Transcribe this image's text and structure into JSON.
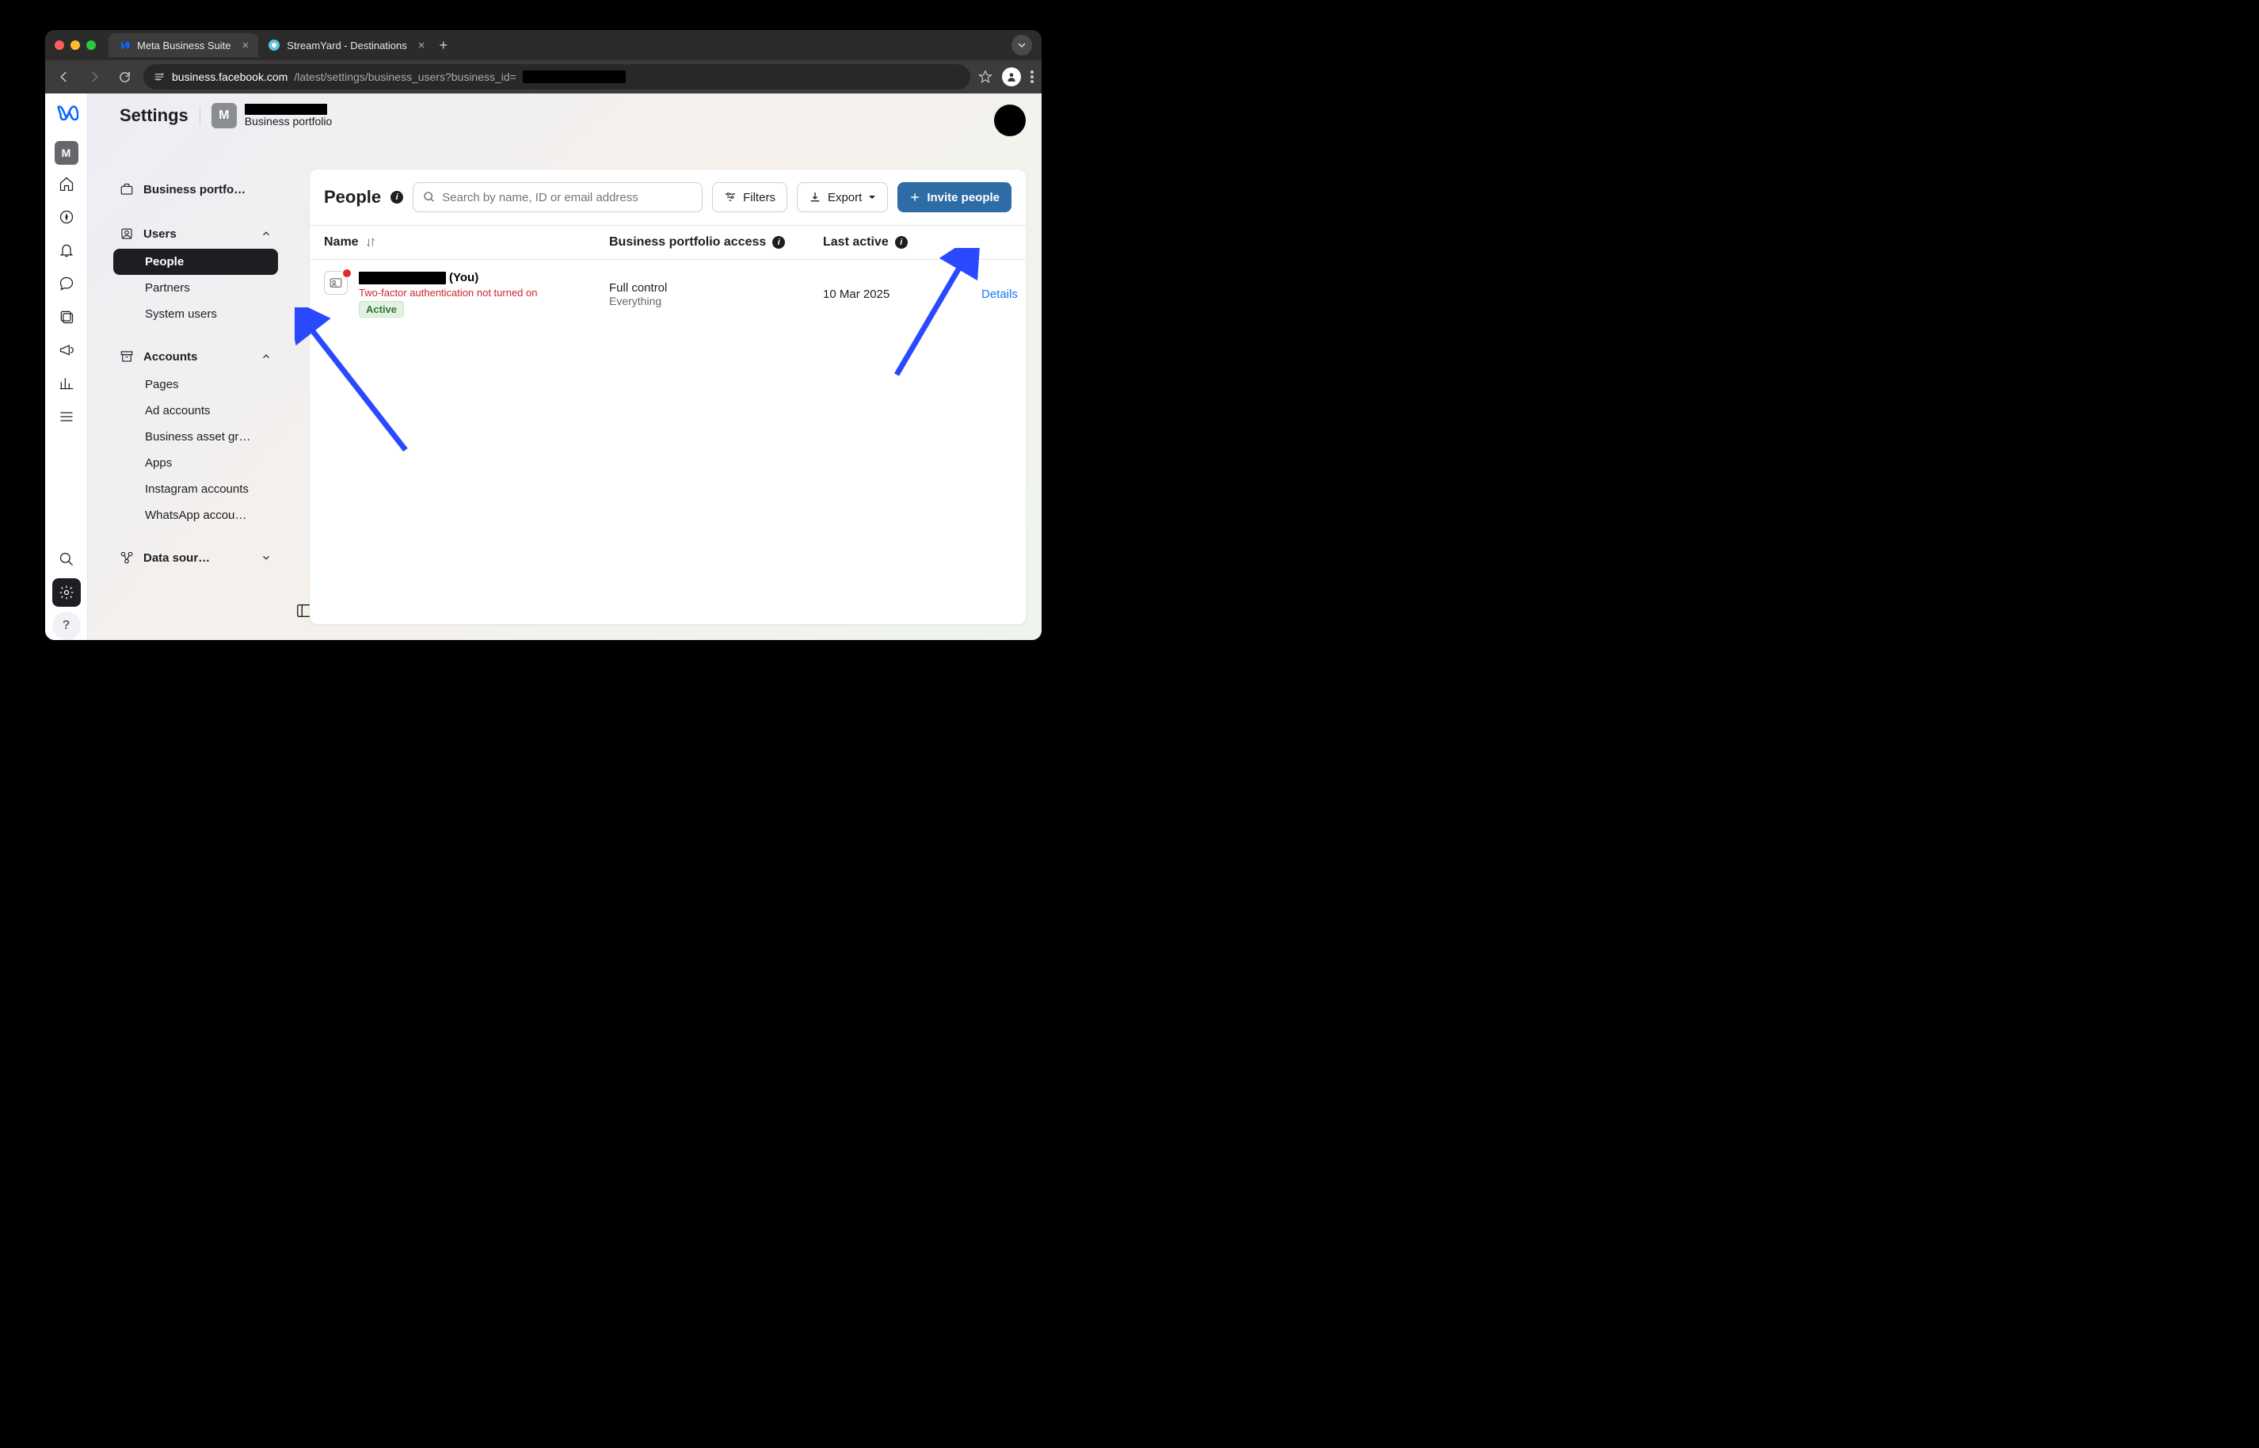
{
  "browser": {
    "tabs": [
      {
        "title": "Meta Business Suite",
        "active": true
      },
      {
        "title": "StreamYard - Destinations",
        "active": false
      }
    ],
    "url_prefix": "business.facebook.com",
    "url_rest": "/latest/settings/business_users?business_id="
  },
  "header": {
    "title": "Settings",
    "portfolio_letter": "M",
    "portfolio_sub": "Business portfolio"
  },
  "sidebar": {
    "business_portfolio": "Business portfo…",
    "users_label": "Users",
    "users_items": [
      "People",
      "Partners",
      "System users"
    ],
    "accounts_label": "Accounts",
    "accounts_items": [
      "Pages",
      "Ad accounts",
      "Business asset gr…",
      "Apps",
      "Instagram accounts",
      "WhatsApp accou…"
    ],
    "data_label": "Data sour…"
  },
  "card": {
    "title": "People",
    "search_placeholder": "Search by name, ID or email address",
    "filters": "Filters",
    "export": "Export",
    "invite": "Invite people",
    "col_name": "Name",
    "col_access": "Business portfolio access",
    "col_active": "Last active",
    "row": {
      "you_suffix": "(You)",
      "warn": "Two-factor authentication not turned on",
      "status": "Active",
      "access": "Full control",
      "access_sub": "Everything",
      "last_active": "10 Mar 2025",
      "details": "Details"
    }
  }
}
